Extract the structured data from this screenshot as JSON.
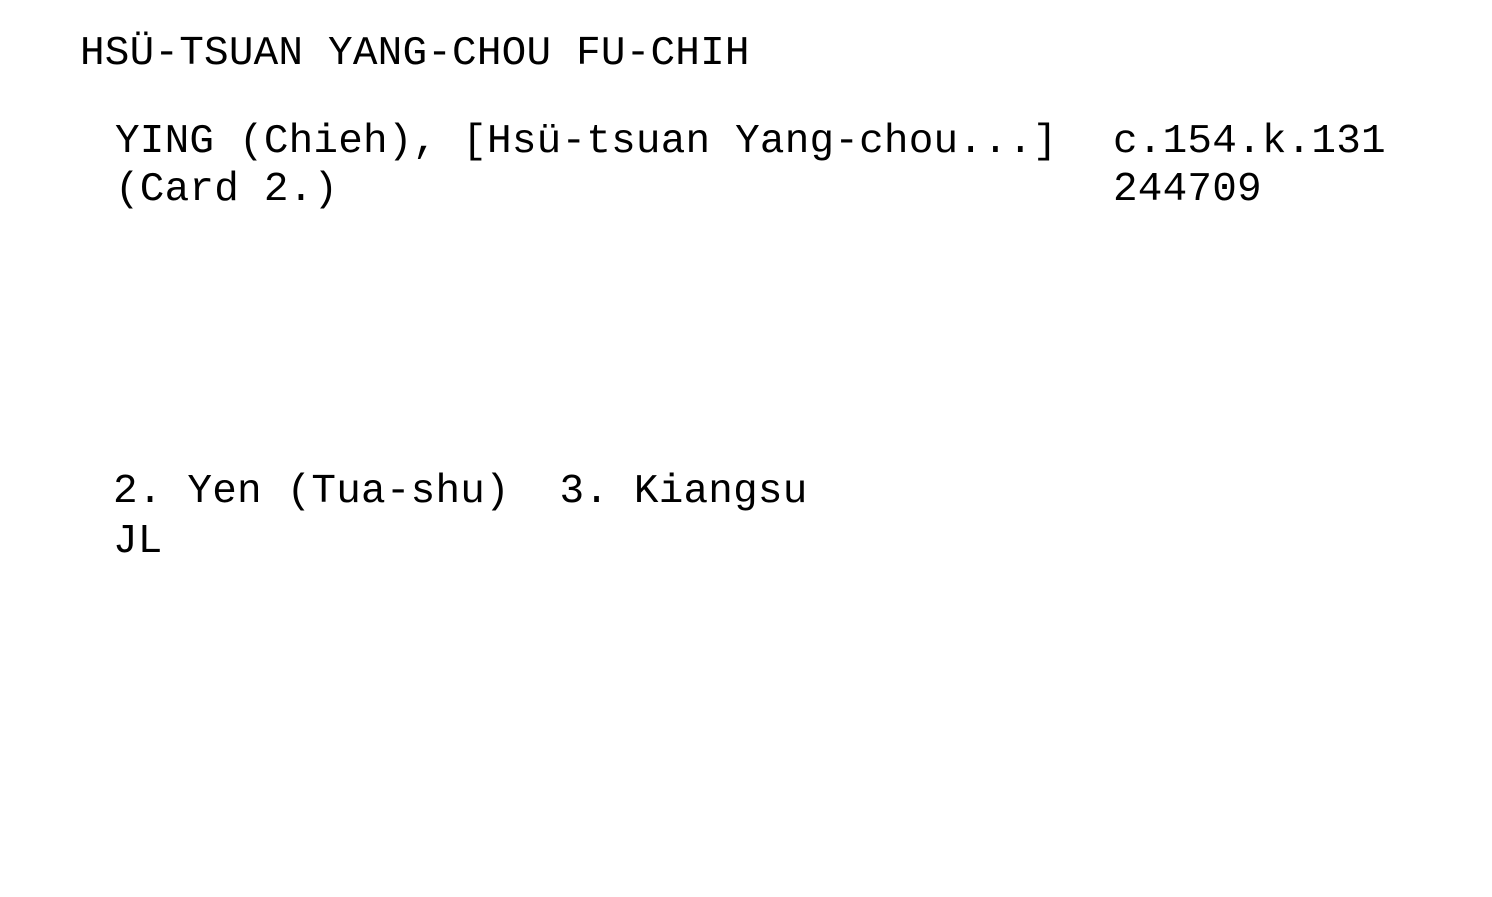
{
  "card": {
    "heading": "HSÜ-TSUAN YANG-CHOU FU-CHIH",
    "entry_line1": "YING (Chieh), [Hsü-tsuan Yang-chou...]",
    "entry_line2": "(Card 2.)",
    "shelfmark": "c.154.k.131",
    "accession_number": "244709",
    "tracings": "2. Yen (Tua-shu)  3. Kiangsu",
    "initials": "JL"
  }
}
